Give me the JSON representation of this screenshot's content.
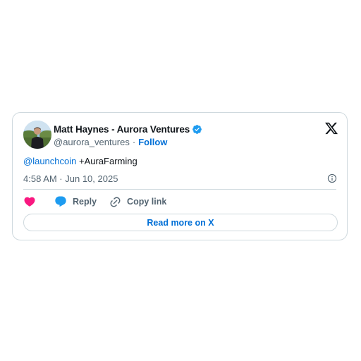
{
  "tweet": {
    "author": {
      "display_name": "Matt Haynes - Aurora Ventures",
      "handle": "@aurora_ventures",
      "verified": true,
      "avatar_icon": "profile-photo"
    },
    "follow_label": "Follow",
    "separator": "·",
    "text": {
      "mention": "@launchcoin",
      "body": " +AuraFarming"
    },
    "timestamp": "4:58 AM · Jun 10, 2025",
    "actions": {
      "like_icon": "heart-icon",
      "reply_label": "Reply",
      "copy_label": "Copy link"
    },
    "read_more_label": "Read more on X"
  },
  "colors": {
    "link_blue": "#006fd6",
    "verified_blue": "#1d9bf0",
    "like_pink": "#f91880",
    "muted_text": "#536471",
    "border": "#cfd9de"
  }
}
